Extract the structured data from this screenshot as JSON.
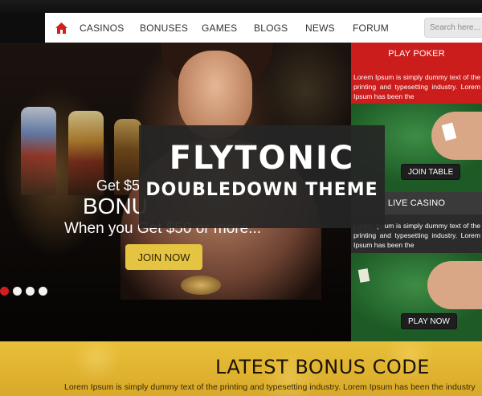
{
  "nav": {
    "items": [
      "CASINOS",
      "BONUSES",
      "GAMES",
      "BLOGS",
      "NEWS",
      "FORUM"
    ],
    "search_placeholder": "Search here...",
    "home_icon": "home-icon"
  },
  "hero": {
    "line1": "Get $5",
    "line2": "BONU",
    "line3": "When you Get $50 or more...",
    "join_label": "JOIN NOW",
    "slides": 4,
    "active_slide": 1
  },
  "side": {
    "poker": {
      "title": "PLAY POKER",
      "text": "Lorem Ipsum is simply dummy text of the printing and typesetting industry. Lorem Ipsum has been the",
      "button": "JOIN TABLE"
    },
    "casino": {
      "title": "LIVE CASINO",
      "text": "Lorem Ipsum is simply dummy text of the printing and typesetting industry. Lorem Ipsum has been the",
      "button": "PLAY NOW"
    }
  },
  "overlay": {
    "title": "FLYTONIC",
    "subtitle": "DOUBLEDOWN THEME"
  },
  "bonus": {
    "title": "LATEST BONUS CODE",
    "text": "Lorem Ipsum is simply dummy text of the printing and typesetting industry. Lorem Ipsum has been the industry"
  },
  "colors": {
    "accent_red": "#cc1d1d",
    "accent_gold": "#e5c441",
    "nav_bg": "#ffffff"
  }
}
